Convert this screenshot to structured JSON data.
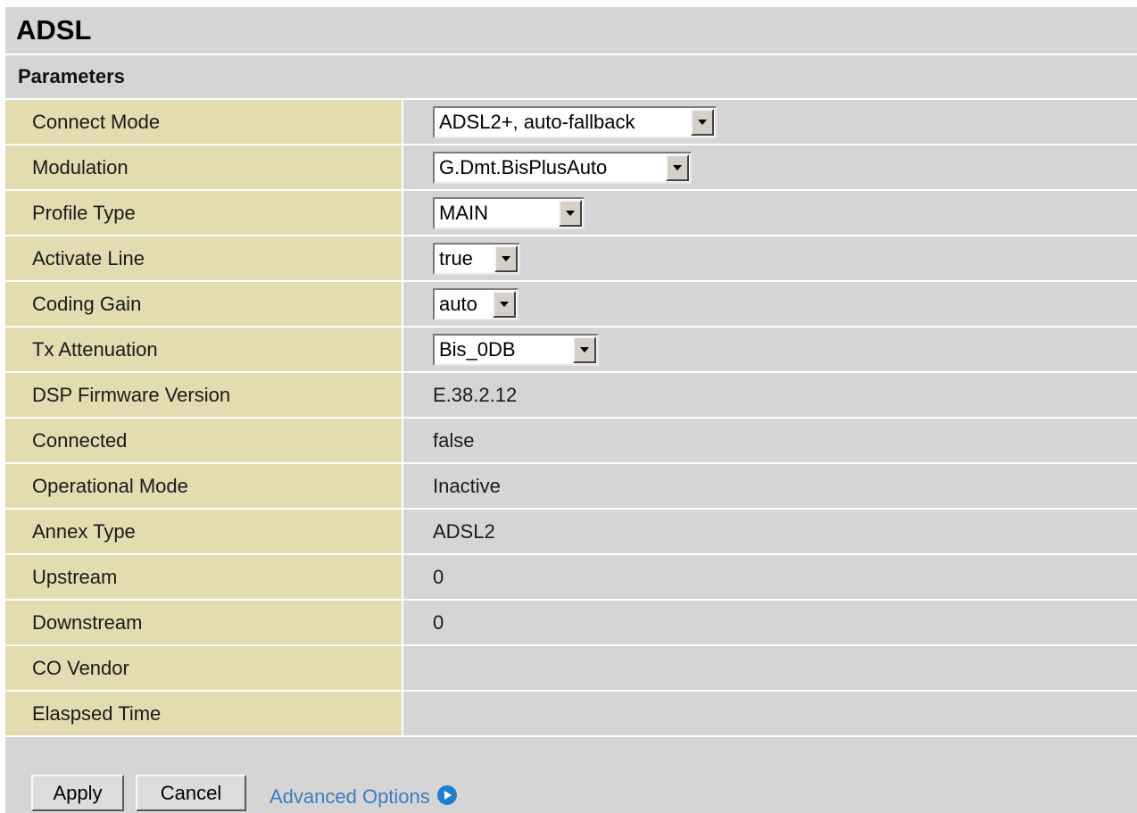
{
  "page": {
    "title": "ADSL"
  },
  "section": {
    "title": "Parameters"
  },
  "params": {
    "connect_mode": {
      "label": "Connect Mode",
      "value": "ADSL2+, auto-fallback"
    },
    "modulation": {
      "label": "Modulation",
      "value": "G.Dmt.BisPlusAuto"
    },
    "profile_type": {
      "label": "Profile Type",
      "value": "MAIN"
    },
    "activate_line": {
      "label": "Activate Line",
      "value": "true"
    },
    "coding_gain": {
      "label": "Coding Gain",
      "value": "auto"
    },
    "tx_attenuation": {
      "label": "Tx Attenuation",
      "value": "Bis_0DB"
    },
    "dsp_firmware_version": {
      "label": "DSP Firmware Version",
      "value": "E.38.2.12"
    },
    "connected": {
      "label": "Connected",
      "value": "false"
    },
    "operational_mode": {
      "label": "Operational Mode",
      "value": "Inactive"
    },
    "annex_type": {
      "label": "Annex Type",
      "value": "ADSL2"
    },
    "upstream": {
      "label": "Upstream",
      "value": "0"
    },
    "downstream": {
      "label": "Downstream",
      "value": "0"
    },
    "co_vendor": {
      "label": "CO Vendor",
      "value": ""
    },
    "elapsed_time": {
      "label": "Elaspsed Time",
      "value": ""
    }
  },
  "buttons": {
    "apply": "Apply",
    "cancel": "Cancel",
    "advanced_options": "Advanced Options"
  },
  "icons": {
    "select_arrow": "chevron-down-icon",
    "advanced": "circle-arrow-right-icon"
  },
  "colors": {
    "label_bg": "#e2dcb0",
    "panel_bg": "#d6d5d5",
    "link": "#3b7ebf",
    "link_icon": "#1f7fd1"
  }
}
